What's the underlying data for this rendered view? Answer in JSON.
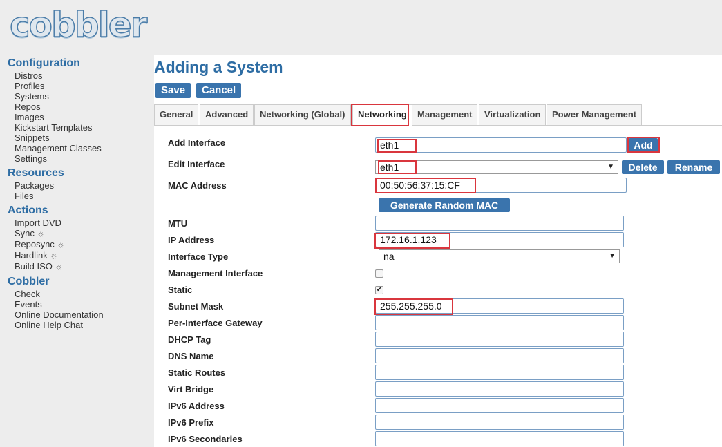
{
  "logo": {
    "text": "cobbler"
  },
  "sidebar": {
    "sections": [
      {
        "heading": "Configuration",
        "items": [
          "Distros",
          "Profiles",
          "Systems",
          "Repos",
          "Images",
          "Kickstart Templates",
          "Snippets",
          "Management Classes",
          "Settings"
        ]
      },
      {
        "heading": "Resources",
        "items": [
          "Packages",
          "Files"
        ]
      },
      {
        "heading": "Actions",
        "items": [
          "Import DVD",
          "Sync",
          "Reposync",
          "Hardlink",
          "Build ISO"
        ]
      },
      {
        "heading": "Cobbler",
        "items": [
          "Check",
          "Events",
          "Online Documentation",
          "Online Help Chat"
        ]
      }
    ],
    "gear_glyph": "☼"
  },
  "page": {
    "title": "Adding a System",
    "save_label": "Save",
    "cancel_label": "Cancel"
  },
  "tabs": [
    "General",
    "Advanced",
    "Networking (Global)",
    "Networking",
    "Management",
    "Virtualization",
    "Power Management"
  ],
  "active_tab": "Networking",
  "form": {
    "add_interface": {
      "label": "Add Interface",
      "value": "eth1",
      "button": "Add"
    },
    "edit_interface": {
      "label": "Edit Interface",
      "value": "eth1",
      "delete": "Delete",
      "rename": "Rename"
    },
    "mac_address": {
      "label": "MAC Address",
      "value": "00:50:56:37:15:CF",
      "button": "Generate Random MAC"
    },
    "mtu": {
      "label": "MTU",
      "value": ""
    },
    "ip_address": {
      "label": "IP Address",
      "value": "172.16.1.123"
    },
    "interface_type": {
      "label": "Interface Type",
      "value": "na"
    },
    "management_interface": {
      "label": "Management Interface",
      "checked": false
    },
    "static": {
      "label": "Static",
      "checked": true
    },
    "subnet_mask": {
      "label": "Subnet Mask",
      "value": "255.255.255.0"
    },
    "per_interface_gateway": {
      "label": "Per-Interface Gateway",
      "value": ""
    },
    "dhcp_tag": {
      "label": "DHCP Tag",
      "value": ""
    },
    "dns_name": {
      "label": "DNS Name",
      "value": ""
    },
    "static_routes": {
      "label": "Static Routes",
      "value": ""
    },
    "virt_bridge": {
      "label": "Virt Bridge",
      "value": ""
    },
    "ipv6_address": {
      "label": "IPv6 Address",
      "value": ""
    },
    "ipv6_prefix": {
      "label": "IPv6 Prefix",
      "value": ""
    },
    "ipv6_secondaries": {
      "label": "IPv6 Secondaries",
      "value": ""
    }
  },
  "colors": {
    "accent": "#2e6da4",
    "button": "#3a74ad",
    "highlight": "#d9363e"
  }
}
